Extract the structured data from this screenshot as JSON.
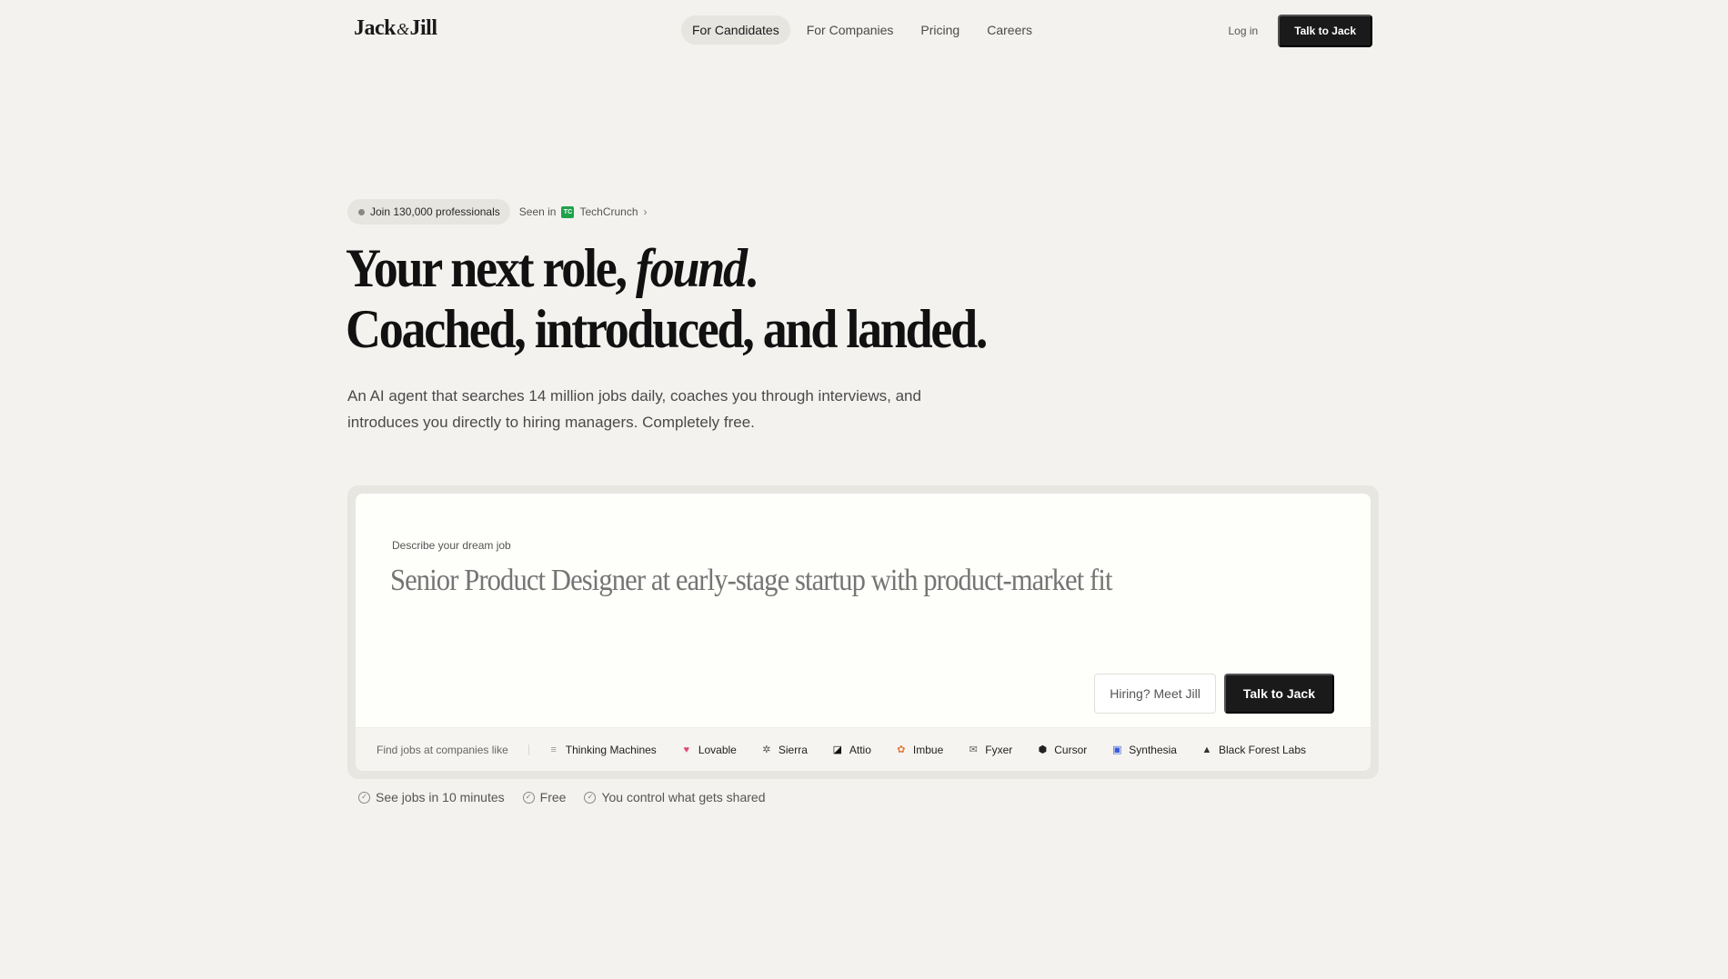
{
  "nav": {
    "logo_left": "Jack",
    "logo_amp": "&",
    "logo_right": "Jill",
    "links": [
      "For Candidates",
      "For Companies",
      "Pricing",
      "Careers"
    ],
    "login": "Log in",
    "cta": "Talk to Jack"
  },
  "badges": {
    "join": "Join 130,000 professionals",
    "seen_in": "Seen in",
    "tc_icon": "TC",
    "techcrunch": "TechCrunch",
    "chevron": "›"
  },
  "hero": {
    "line1_pre": "Your next role, ",
    "line1_em": "found",
    "line1_post": ".",
    "line2": "Coached, introduced, and landed.",
    "sub": "An AI agent that searches 14 million jobs daily, coaches you through interviews, and introduces you directly to hiring managers. Completely free."
  },
  "card": {
    "label": "Describe your dream job",
    "placeholder": "Senior Product Designer at early-stage startup with product-market fit",
    "hiring_button": "Hiring? Meet Jill",
    "cta": "Talk to Jack",
    "find_label": "Find jobs at companies like",
    "companies": [
      {
        "name": "Thinking Machines",
        "icon": "lines-icon",
        "glyph": "≡",
        "color": "#999999"
      },
      {
        "name": "Lovable",
        "icon": "heart-icon",
        "glyph": "♥",
        "color": "#e24a7a"
      },
      {
        "name": "Sierra",
        "icon": "gear-icon",
        "glyph": "✲",
        "color": "#555555"
      },
      {
        "name": "Attio",
        "icon": "attio-icon",
        "glyph": "◪",
        "color": "#111111"
      },
      {
        "name": "Imbue",
        "icon": "imbue-icon",
        "glyph": "✿",
        "color": "#e07a3a"
      },
      {
        "name": "Fyxer",
        "icon": "fyxer-icon",
        "glyph": "✉",
        "color": "#666666"
      },
      {
        "name": "Cursor",
        "icon": "cube-icon",
        "glyph": "⬢",
        "color": "#222222"
      },
      {
        "name": "Synthesia",
        "icon": "synthesia-icon",
        "glyph": "▣",
        "color": "#3b5bdb"
      },
      {
        "name": "Black Forest Labs",
        "icon": "triangle-icon",
        "glyph": "▲",
        "color": "#333333"
      }
    ]
  },
  "checks": [
    "See jobs in 10 minutes",
    "Free",
    "You control what gets shared"
  ],
  "check_glyph": "✓"
}
